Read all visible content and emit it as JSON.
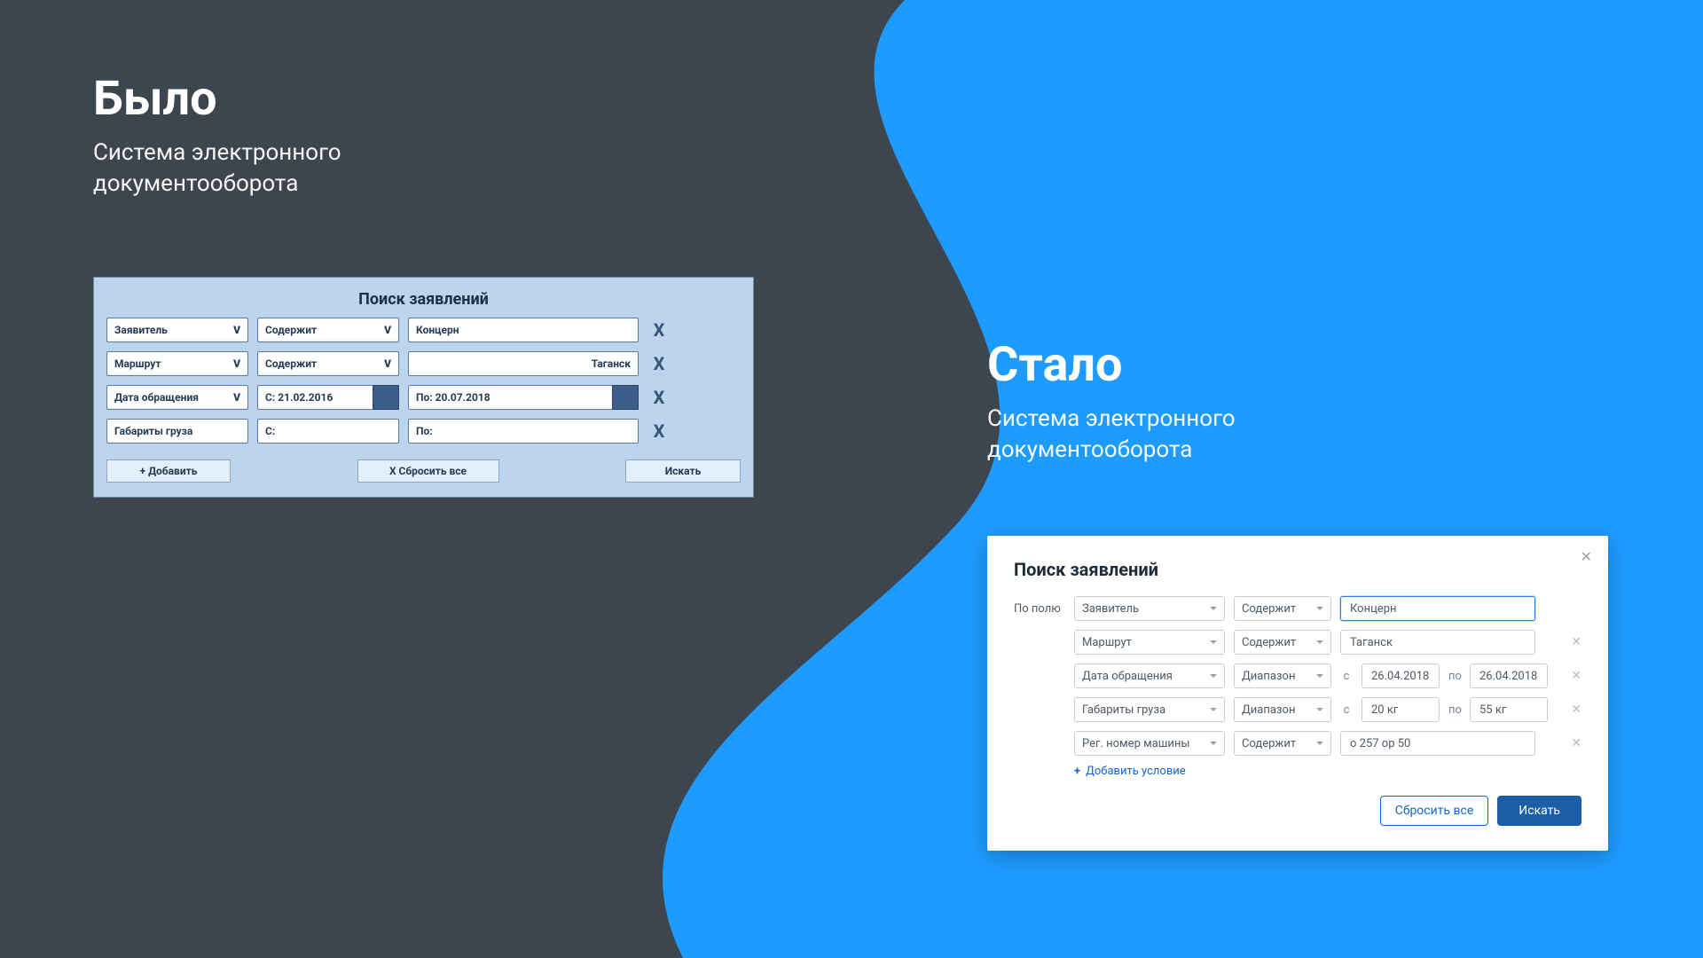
{
  "headings": {
    "before_title": "Было",
    "before_sub": "Система электронного\nдокументооборота",
    "after_title": "Стало",
    "after_sub": "Система электронного\nдокументооборота"
  },
  "old": {
    "title": "Поиск заявлений",
    "caret": "V",
    "x": "X",
    "rows": [
      {
        "field": "Заявитель",
        "op": "Содержит",
        "value": "Концерн",
        "value_align": "left"
      },
      {
        "field": "Маршрут",
        "op": "Содержит",
        "value": "Таганск",
        "value_align": "right"
      },
      {
        "field": "Дата обращения",
        "from_lbl": "С:",
        "from": "21.02.2016",
        "to_lbl": "По:",
        "to": "20.07.2018"
      },
      {
        "field": "Габариты груза",
        "from_lbl": "С:",
        "from": "",
        "to_lbl": "По:",
        "to": ""
      }
    ],
    "actions": {
      "add": "+ Добавить",
      "reset": "X Сбросить все",
      "search": "Искать"
    }
  },
  "new": {
    "title": "Поиск заявлений",
    "field_label": "По полю",
    "rows": [
      {
        "field": "Заявитель",
        "op": "Содержит",
        "value": "Концерн",
        "active": true,
        "closable": false
      },
      {
        "field": "Маршрут",
        "op": "Содержит",
        "value": "Таганск",
        "closable": true
      },
      {
        "field": "Дата обращения",
        "op": "Диапазон",
        "from_lbl": "с",
        "from": "26.04.2018",
        "to_lbl": "по",
        "to": "26.04.2018",
        "closable": true
      },
      {
        "field": "Габариты груза",
        "op": "Диапазон",
        "from_lbl": "с",
        "from": "20 кг",
        "to_lbl": "по",
        "to": "55 кг",
        "closable": true
      },
      {
        "field": "Рег. номер машины",
        "op": "Содержит",
        "value": "о 257 ор 50",
        "closable": true
      }
    ],
    "add_label": "Добавить условие",
    "actions": {
      "reset": "Сбросить все",
      "search": "Искать"
    }
  }
}
